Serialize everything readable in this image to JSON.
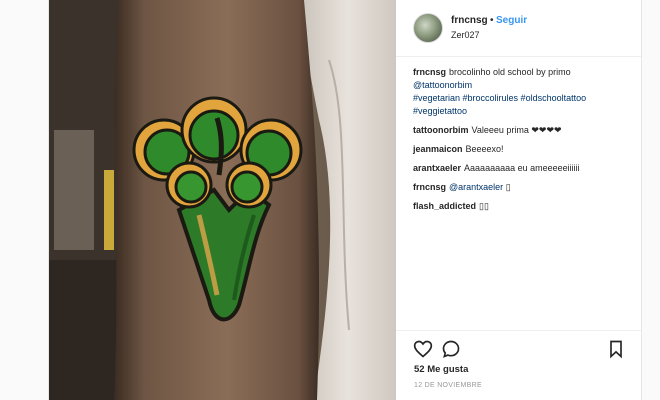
{
  "post": {
    "user": "frncnsg",
    "separator": "•",
    "follow_label": "Seguir",
    "location": "Zer027",
    "caption": {
      "user": "frncnsg",
      "text": "brocolinho old school by primo",
      "mention": "@tattoonorbim",
      "hashtags": "#vegetarian #broccolirules #oldschooltattoo #veggietattoo"
    },
    "comments": [
      {
        "user": "tattoonorbim",
        "text": "Valeeeu prima ❤❤❤❤"
      },
      {
        "user": "jeanmaicon",
        "text": "Beeeexo!"
      },
      {
        "user": "arantxaeler",
        "text": "Aaaaaaaaaa eu ameeeeeiiiiii"
      },
      {
        "user": "frncnsg",
        "mention": "@arantxaeler",
        "text": "▯"
      },
      {
        "user": "flash_addicted",
        "text": "▯▯"
      }
    ],
    "likes": "52 Me gusta",
    "date": "12 DE NOVIEMBRE",
    "icons": [
      "heart-icon",
      "comment-icon",
      "bookmark-icon"
    ]
  },
  "colors": {
    "link": "#3897f0",
    "hashtag": "#003569",
    "text": "#262626"
  }
}
